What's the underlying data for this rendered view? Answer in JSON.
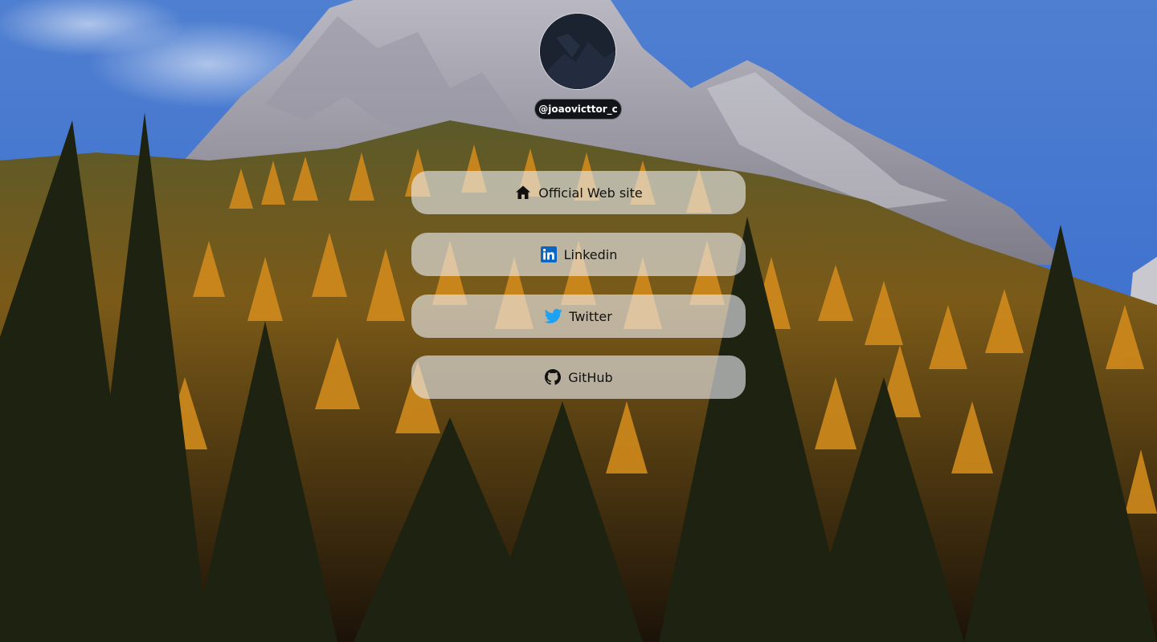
{
  "profile": {
    "username": "@joaovicttor_c"
  },
  "links": [
    {
      "label": "Official Web site",
      "icon": "home-icon"
    },
    {
      "label": "Linkedin",
      "icon": "linkedin-icon"
    },
    {
      "label": "Twitter",
      "icon": "twitter-icon"
    },
    {
      "label": "GitHub",
      "icon": "github-icon"
    }
  ],
  "colors": {
    "button_background": "#eceef2",
    "username_badge": "#111418",
    "linkedin_blue": "#0a66c2",
    "twitter_blue": "#1da1f2"
  }
}
